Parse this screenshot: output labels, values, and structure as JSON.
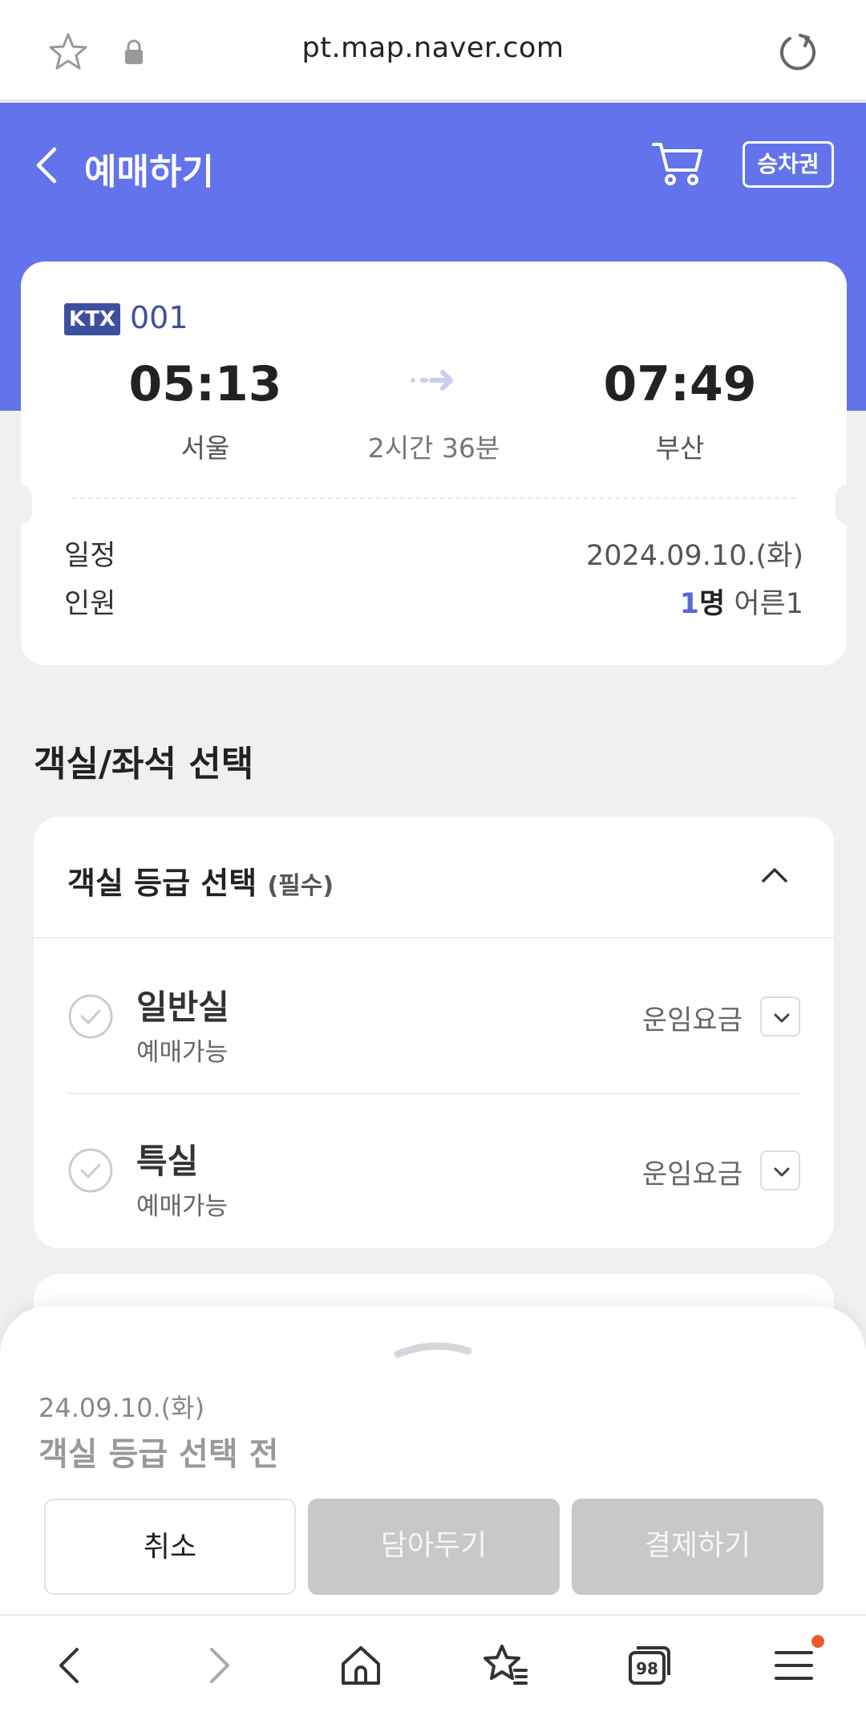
{
  "browser": {
    "url": "pt.map.naver.com",
    "tabs_count": "98"
  },
  "header": {
    "title": "예매하기",
    "ticket_button": "승차권"
  },
  "train": {
    "type": "KTX",
    "number": "001",
    "departure_time": "05:13",
    "departure_station": "서울",
    "duration": "2시간 36분",
    "arrival_time": "07:49",
    "arrival_station": "부산",
    "schedule_label": "일정",
    "schedule_value": "2024.09.10.(화)",
    "people_label": "인원",
    "people_count": "1",
    "people_unit": "명",
    "people_detail": " 어른1"
  },
  "seat_section": {
    "title": "객실/좌석 선택",
    "panel_title": "객실 등급 선택",
    "required": "(필수)",
    "options": [
      {
        "name": "일반실",
        "status": "예매가능",
        "fare_label": "운임요금"
      },
      {
        "name": "특실",
        "status": "예매가능",
        "fare_label": "운임요금"
      }
    ]
  },
  "bottom_sheet": {
    "date": "24.09.10.(화)",
    "status": "객실 등급 선택 전",
    "cancel": "취소",
    "save": "담아두기",
    "pay": "결제하기"
  },
  "colors": {
    "header_bg": "#6373ec",
    "accent": "#5a67d8",
    "badge": "#3f4fa0",
    "notification_dot": "#ec5a2c"
  }
}
